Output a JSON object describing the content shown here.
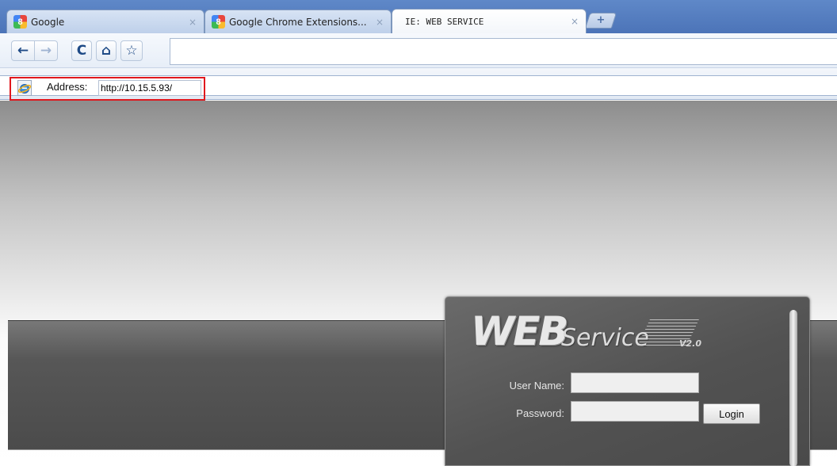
{
  "tabs": [
    {
      "title": "Google",
      "close": "×",
      "favicon_letter": "8"
    },
    {
      "title": "Google Chrome Extensions...",
      "close": "×",
      "favicon_letter": "8"
    },
    {
      "title": "IE: WEB SERVICE",
      "close": "×",
      "active": true
    }
  ],
  "new_tab_symbol": "+",
  "toolbar": {
    "back": "←",
    "forward": "→",
    "reload": "C",
    "home": "⌂",
    "star": "☆"
  },
  "ie_bar": {
    "address_label": "Address:",
    "address_value": "http://10.15.5.93/"
  },
  "login": {
    "logo_web": "WEB",
    "logo_service": "Service",
    "logo_version": "V2.0",
    "username_label": "User Name:",
    "username_value": "",
    "password_label": "Password:",
    "password_value": "",
    "login_button": "Login"
  },
  "colors": {
    "highlight": "#e0181e",
    "tabstrip": "#4c74b8"
  }
}
